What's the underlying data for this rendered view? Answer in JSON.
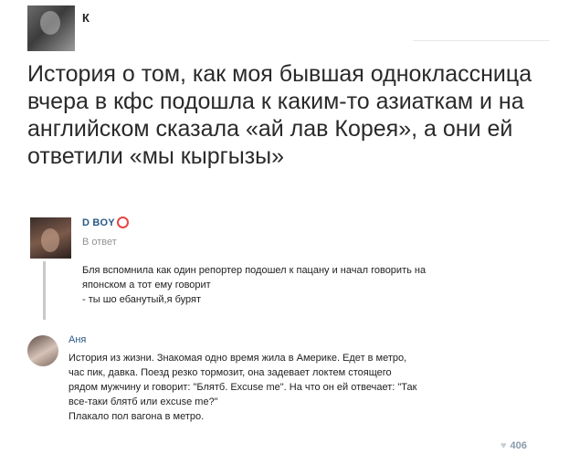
{
  "post": {
    "author": "К",
    "text": "История о том, как моя бывшая одноклассница вчера в кфс подошла к каким-то азиаткам и на английском сказала «ай лав Корея», а они ей ответили «мы кыргызы»"
  },
  "quote": {
    "author": "D BOY",
    "subtitle": "В ответ",
    "lines": [
      "Бля вспомнила как один репортер подошел к пацану и начал говорить на",
      "японском а тот ему говорит",
      "- ты шо ебанутый,я бурят"
    ]
  },
  "comment": {
    "author": "Аня",
    "lines": [
      "История из жизни. Знакомая одно время жила в Америке. Едет в метро,",
      "час пик, давка. Поезд резко тормозит, она задевает локтем стоящего",
      "рядом мужчину и говорит: \"Блятб. Excuse me\". На что он ей отвечает: \"Так",
      "все-таки блятб или excuse me?\"",
      "Плакало пол вагона в метро."
    ],
    "likes": "406"
  },
  "icons": {
    "ring": "ring-icon",
    "heart": "heart-icon"
  },
  "colors": {
    "link": "#2a5885",
    "accent_ring": "#e64646",
    "muted": "#939393"
  }
}
